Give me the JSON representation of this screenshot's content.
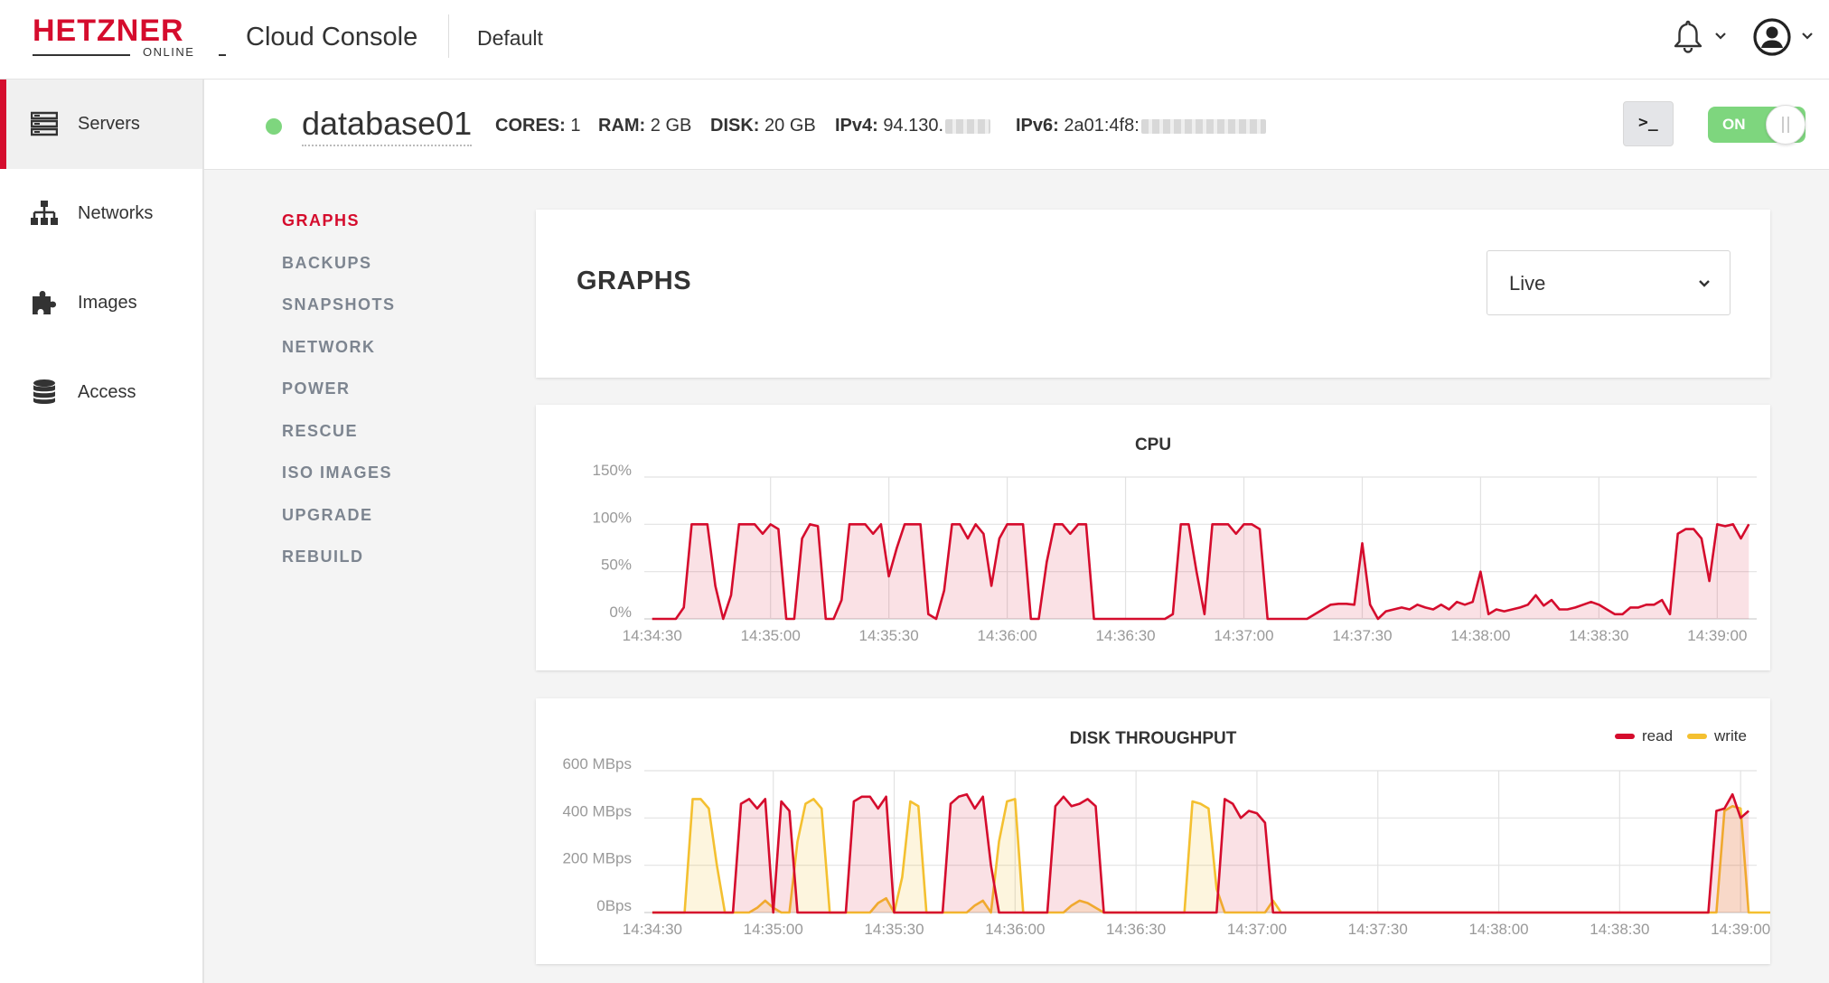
{
  "app": {
    "logo_text": "HETZNER",
    "logo_subtext": "ONLINE",
    "title": "Cloud Console",
    "project": "Default"
  },
  "icons": {
    "bell": "bell-icon",
    "avatar": "user-avatar-icon",
    "servers": "server-stack-icon",
    "networks": "network-tree-icon",
    "images": "puzzle-icon",
    "access": "database-icon",
    "console": "terminal-icon"
  },
  "sidebar": {
    "items": [
      {
        "label": "Servers",
        "active": true
      },
      {
        "label": "Networks",
        "active": false
      },
      {
        "label": "Images",
        "active": false
      },
      {
        "label": "Access",
        "active": false
      }
    ]
  },
  "server": {
    "name": "database01",
    "status_color": "#7ed67e",
    "cores_label": "CORES:",
    "cores": "1",
    "ram_label": "RAM:",
    "ram": "2 GB",
    "disk_label": "DISK:",
    "disk": "20 GB",
    "ipv4_label": "IPv4:",
    "ipv4": "94.130.",
    "ipv6_label": "IPv6:",
    "ipv6": "2a01:4f8:",
    "console_label": ">_",
    "power_label": "ON"
  },
  "subnav": [
    {
      "label": "GRAPHS",
      "active": true
    },
    {
      "label": "BACKUPS",
      "active": false
    },
    {
      "label": "SNAPSHOTS",
      "active": false
    },
    {
      "label": "NETWORK",
      "active": false
    },
    {
      "label": "POWER",
      "active": false
    },
    {
      "label": "RESCUE",
      "active": false
    },
    {
      "label": "ISO IMAGES",
      "active": false
    },
    {
      "label": "UPGRADE",
      "active": false
    },
    {
      "label": "REBUILD",
      "active": false
    }
  ],
  "graphs": {
    "title": "GRAPHS",
    "range_selected": "Live"
  },
  "colors": {
    "accent": "#d50c2d",
    "read": "#d50c2d",
    "write": "#f4c030",
    "on": "#7ed67e"
  },
  "chart_data": [
    {
      "type": "area",
      "title": "CPU",
      "yticks": [
        "0%",
        "50%",
        "100%",
        "150%"
      ],
      "ylim": [
        0,
        150
      ],
      "xticks": [
        "14:34:30",
        "14:35:00",
        "14:35:30",
        "14:36:00",
        "14:36:30",
        "14:37:00",
        "14:37:30",
        "14:38:00",
        "14:38:30",
        "14:39:00"
      ],
      "x_start": "14:34:28",
      "x_step_seconds": 2,
      "grid": true,
      "series": [
        {
          "values": [
            0,
            0,
            0,
            0,
            12,
            100,
            100,
            100,
            35,
            0,
            25,
            100,
            100,
            100,
            90,
            100,
            95,
            0,
            0,
            85,
            100,
            98,
            0,
            0,
            20,
            100,
            100,
            100,
            90,
            100,
            45,
            75,
            100,
            100,
            100,
            5,
            0,
            30,
            100,
            100,
            85,
            100,
            90,
            35,
            85,
            100,
            100,
            100,
            0,
            0,
            60,
            100,
            100,
            90,
            100,
            100,
            0,
            0,
            0,
            0,
            0,
            0,
            0,
            0,
            0,
            0,
            5,
            100,
            100,
            50,
            5,
            100,
            100,
            100,
            90,
            100,
            100,
            95,
            0,
            0,
            0,
            0,
            0,
            0,
            5,
            10,
            15,
            16,
            16,
            15,
            80,
            15,
            0,
            8,
            10,
            12,
            10,
            15,
            12,
            10,
            15,
            10,
            18,
            15,
            18,
            50,
            5,
            10,
            8,
            10,
            12,
            15,
            25,
            14,
            20,
            10,
            10,
            12,
            15,
            18,
            15,
            10,
            5,
            5,
            12,
            12,
            15,
            15,
            20,
            5,
            90,
            95,
            95,
            85,
            40,
            100,
            98,
            100,
            85,
            100
          ]
        }
      ]
    },
    {
      "type": "area",
      "title": "DISK THROUGHPUT",
      "yticks": [
        "0Bps",
        "200 MBps",
        "400 MBps",
        "600 MBps"
      ],
      "ylim": [
        0,
        600
      ],
      "xticks": [
        "14:34:30",
        "14:35:00",
        "14:35:30",
        "14:36:00",
        "14:36:30",
        "14:37:00",
        "14:37:30",
        "14:38:00",
        "14:38:30",
        "14:39:00"
      ],
      "legend": "top-right",
      "x_start": "14:34:28",
      "x_step_seconds": 2,
      "grid": true,
      "series": [
        {
          "name": "read",
          "values": [
            0,
            0,
            0,
            0,
            0,
            0,
            0,
            0,
            0,
            0,
            0,
            460,
            480,
            440,
            480,
            0,
            470,
            430,
            0,
            0,
            0,
            0,
            0,
            0,
            0,
            470,
            490,
            490,
            440,
            490,
            0,
            0,
            0,
            0,
            0,
            0,
            0,
            460,
            490,
            500,
            440,
            490,
            200,
            0,
            0,
            0,
            0,
            0,
            0,
            0,
            450,
            490,
            450,
            460,
            480,
            450,
            0,
            0,
            0,
            0,
            0,
            0,
            0,
            0,
            0,
            0,
            0,
            0,
            0,
            0,
            0,
            480,
            460,
            400,
            430,
            420,
            380,
            0,
            0,
            0,
            0,
            0,
            0,
            0,
            0,
            0,
            0,
            0,
            0,
            0,
            0,
            0,
            0,
            0,
            0,
            0,
            0,
            0,
            0,
            0,
            0,
            0,
            0,
            0,
            0,
            0,
            0,
            0,
            0,
            0,
            0,
            0,
            0,
            0,
            0,
            0,
            0,
            0,
            0,
            0,
            0,
            0,
            0,
            0,
            0,
            0,
            0,
            0,
            0,
            0,
            0,
            0,
            430,
            440,
            500,
            400,
            430
          ]
        },
        {
          "name": "write",
          "values": [
            0,
            0,
            0,
            0,
            0,
            480,
            480,
            440,
            200,
            0,
            0,
            0,
            0,
            20,
            50,
            20,
            0,
            0,
            300,
            460,
            480,
            440,
            0,
            0,
            0,
            0,
            0,
            0,
            40,
            60,
            0,
            150,
            470,
            450,
            0,
            0,
            0,
            0,
            0,
            0,
            30,
            50,
            0,
            300,
            470,
            480,
            0,
            0,
            0,
            0,
            0,
            0,
            30,
            50,
            40,
            20,
            0,
            0,
            0,
            0,
            0,
            0,
            0,
            0,
            0,
            0,
            0,
            470,
            460,
            440,
            100,
            0,
            0,
            0,
            0,
            0,
            0,
            50,
            0,
            0,
            0,
            0,
            0,
            0,
            0,
            0,
            0,
            0,
            0,
            0,
            0,
            0,
            0,
            0,
            0,
            0,
            0,
            0,
            0,
            0,
            0,
            0,
            0,
            0,
            0,
            0,
            0,
            0,
            0,
            0,
            0,
            0,
            0,
            0,
            0,
            0,
            0,
            0,
            0,
            0,
            0,
            0,
            0,
            0,
            0,
            0,
            0,
            0,
            0,
            0,
            0,
            0,
            0,
            430,
            450,
            440,
            0,
            0,
            0,
            0,
            0,
            40,
            50
          ]
        }
      ]
    }
  ]
}
